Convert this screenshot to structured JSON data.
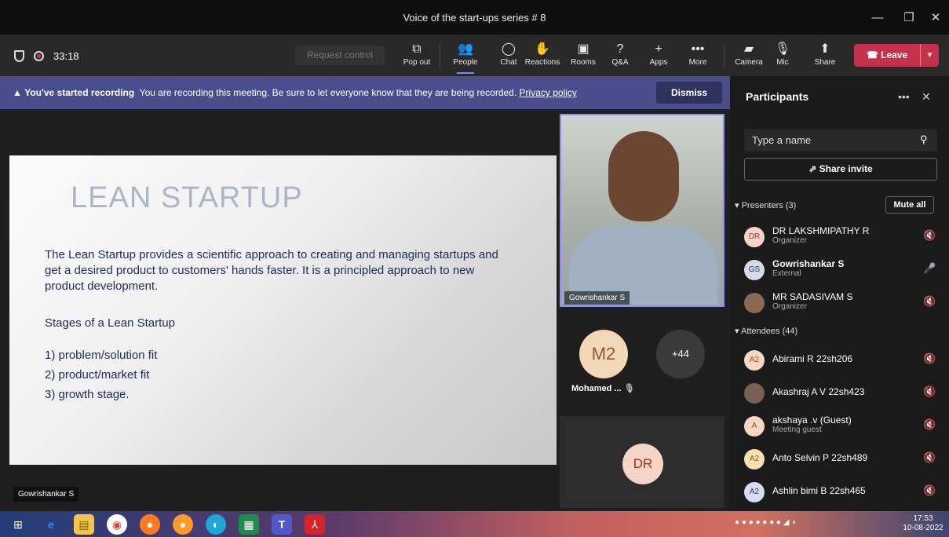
{
  "window": {
    "title": "Voice of the start-ups series # 8",
    "minimize": "—",
    "maximize": "❐",
    "close": "✕"
  },
  "toolbar": {
    "timer": "33:18",
    "request_control": "Request control",
    "buttons": [
      {
        "label": "Pop out",
        "icon": "popout-icon"
      },
      {
        "label": "People",
        "icon": "people-icon"
      },
      {
        "label": "Chat",
        "icon": "chat-icon"
      },
      {
        "label": "Reactions",
        "icon": "reactions-icon"
      },
      {
        "label": "Rooms",
        "icon": "rooms-icon"
      },
      {
        "label": "Q&A",
        "icon": "qa-icon"
      },
      {
        "label": "Apps",
        "icon": "plus-icon"
      },
      {
        "label": "More",
        "icon": "more-icon"
      },
      {
        "label": "Camera",
        "icon": "camera-off-icon"
      },
      {
        "label": "Mic",
        "icon": "mic-off-icon"
      },
      {
        "label": "Share",
        "icon": "share-icon"
      }
    ],
    "leave": "Leave"
  },
  "banner": {
    "bold": "You've started recording",
    "text": "You are recording this meeting. Be sure to let everyone know that they are being recorded.",
    "link": "Privacy policy",
    "dismiss": "Dismiss"
  },
  "slide": {
    "title": "LEAN STARTUP",
    "lines": [
      "The Lean Startup provides a scientific approach to creating and managing startups and",
      "get a desired product to customers' hands faster. It is a principled approach to new",
      "product development.",
      "Stages of a Lean Startup",
      "1) problem/solution fit",
      "2) product/market fit",
      "3) growth stage."
    ]
  },
  "videos": {
    "speaker_name": "Gowrishankar S",
    "tile_m2_initials": "M2",
    "tile_m2_name": "Mohamed ...",
    "more_count": "+44",
    "tile_dr_initials": "DR",
    "presenter_label": "Gowrishankar S"
  },
  "panel": {
    "title": "Participants",
    "search_placeholder": "Type a name",
    "share_invite": "Share invite",
    "presenters_label": "Presenters (3)",
    "mute_all": "Mute all",
    "attendees_label": "Attendees (44)",
    "presenters": [
      {
        "initials": "DR",
        "name": "DR LAKSHMIPATHY R",
        "sub": "Organizer",
        "bg": "#f5d5c8",
        "fg": "#a03020",
        "mic": "muted"
      },
      {
        "initials": "GS",
        "name": "Gowrishankar S",
        "sub": "External",
        "bg": "#d5dbe6",
        "fg": "#203060",
        "mic": "on"
      },
      {
        "initials": "",
        "name": "MR SADASIVAM S",
        "sub": "Organizer",
        "bg": "#8a6a50",
        "fg": "#fff",
        "mic": "muted"
      }
    ],
    "attendees": [
      {
        "initials": "A2",
        "name": "Abirami R 22sh206",
        "sub": "",
        "bg": "#f5d8c0",
        "fg": "#a05020"
      },
      {
        "initials": "",
        "name": "Akashraj A V 22sh423",
        "sub": "",
        "bg": "#7a6050",
        "fg": "#fff"
      },
      {
        "initials": "A",
        "name": "akshaya .v (Guest)",
        "sub": "Meeting guest",
        "bg": "#f5d8c0",
        "fg": "#a05020"
      },
      {
        "initials": "A2",
        "name": "Anto Selvin P 22sh489",
        "sub": "",
        "bg": "#f5e0b0",
        "fg": "#806020"
      },
      {
        "initials": "A2",
        "name": "Ashlin bimi B 22sh465",
        "sub": "",
        "bg": "#d8dcf0",
        "fg": "#303870"
      }
    ]
  },
  "taskbar": {
    "time": "17:53",
    "date": "10-08-2022"
  }
}
